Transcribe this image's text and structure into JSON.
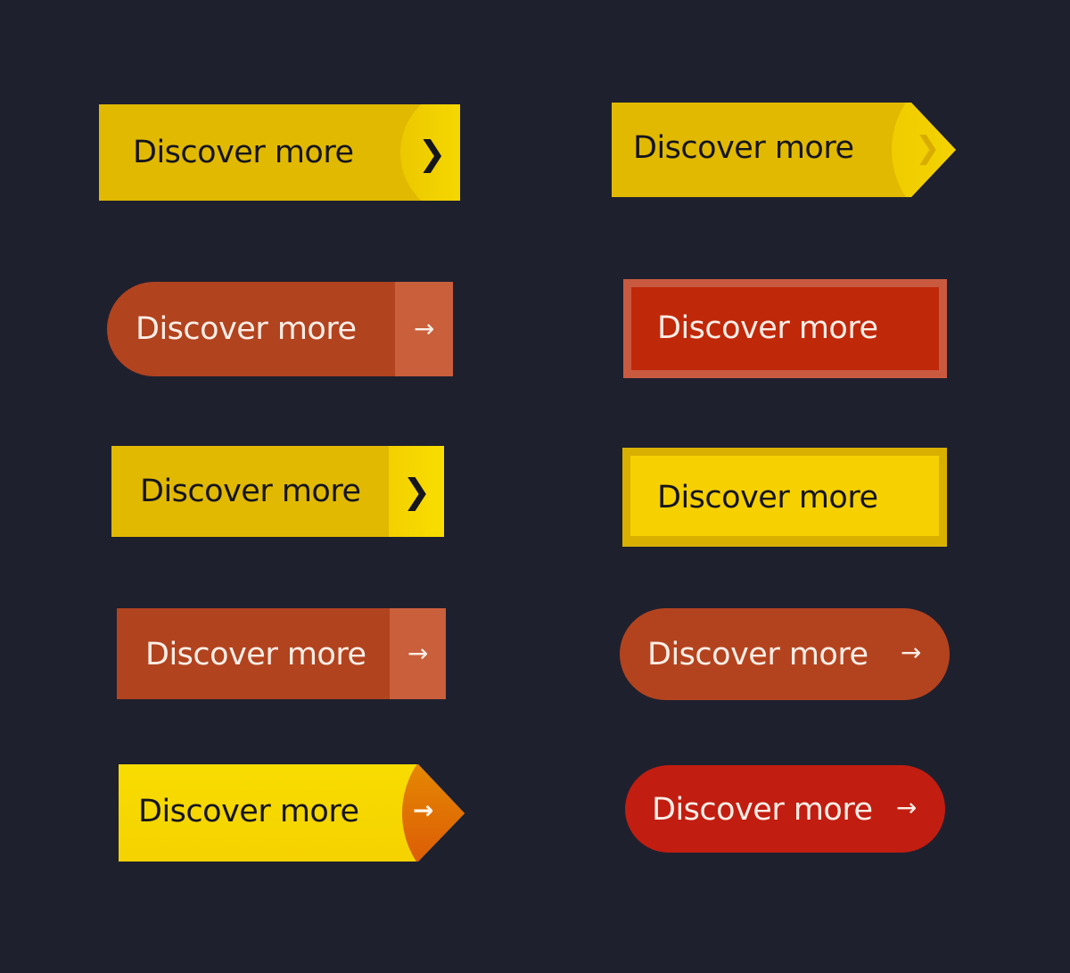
{
  "colors": {
    "background": "#1f202e",
    "yellow": "#e1b900",
    "bright_yellow": "#f8d800",
    "rust": "#b1431f",
    "rust_light": "#ca5f3c",
    "red": "#c0280a",
    "crimson": "#c21d11",
    "orange_tip": "#e37a00"
  },
  "buttons": [
    {
      "id": "yellow-circle-chevron",
      "label": "Discover more",
      "icon": "chevron-right-icon",
      "glyph": "❯"
    },
    {
      "id": "yellow-arrow-tag",
      "label": "Discover more",
      "icon": "chevron-right-icon",
      "glyph": "❯"
    },
    {
      "id": "rust-rounded-left-arrow",
      "label": "Discover more",
      "icon": "arrow-right-icon",
      "glyph": "→"
    },
    {
      "id": "red-framed",
      "label": "Discover more"
    },
    {
      "id": "yellow-split-chevron",
      "label": "Discover more",
      "icon": "chevron-right-icon",
      "glyph": "❯"
    },
    {
      "id": "yellow-bevel",
      "label": "Discover more"
    },
    {
      "id": "rust-split-arrow",
      "label": "Discover more",
      "icon": "arrow-right-icon",
      "glyph": "→"
    },
    {
      "id": "rust-pill-arrow",
      "label": "Discover more",
      "icon": "arrow-right-icon",
      "glyph": "→"
    },
    {
      "id": "yellow-orange-tag-arrow",
      "label": "Discover more",
      "icon": "arrow-right-icon",
      "glyph": "→"
    },
    {
      "id": "red-pill-arrow",
      "label": "Discover more",
      "icon": "arrow-right-icon",
      "glyph": "→"
    }
  ]
}
